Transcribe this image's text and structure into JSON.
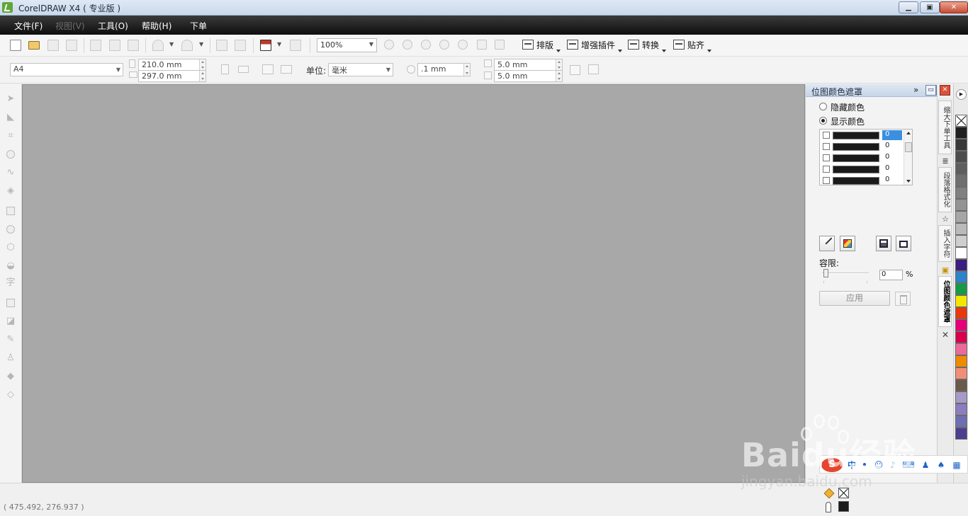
{
  "window": {
    "title": "CorelDRAW X4 ( 专业版 )",
    "buttons": {
      "minimize": "▁",
      "restore": "▣",
      "close": "✕"
    }
  },
  "menu": [
    {
      "label": "文件(F)",
      "enabled": true
    },
    {
      "label": "视图(V)",
      "enabled": false
    },
    {
      "label": "工具(O)",
      "enabled": true
    },
    {
      "label": "帮助(H)",
      "enabled": true
    },
    {
      "label": "下单",
      "enabled": true
    }
  ],
  "toolbar": {
    "zoom": "100%",
    "plugins": [
      "排版",
      "增强插件",
      "转换",
      "贴齐"
    ]
  },
  "property_bar": {
    "page_size": "A4",
    "width": "210.0 mm",
    "height": "297.0 mm",
    "units_label": "单位:",
    "units": "毫米",
    "nudge": ".1 mm",
    "dup_x": "5.0 mm",
    "dup_y": "5.0 mm"
  },
  "docker": {
    "title": "位图颜色遮罩",
    "radio_hide": "隐藏颜色",
    "radio_show": "显示颜色",
    "selected_mode": "show",
    "colors": [
      {
        "value": "0",
        "selected": true
      },
      {
        "value": "0",
        "selected": false
      },
      {
        "value": "0",
        "selected": false
      },
      {
        "value": "0",
        "selected": false
      },
      {
        "value": "0",
        "selected": false
      }
    ],
    "tolerance_label": "容限:",
    "tolerance_value": "0",
    "percent": "%",
    "apply_label": "应用"
  },
  "side_tabs": [
    "缩大下单工具",
    "段落格式化",
    "插入字符",
    "位图颜色遮罩"
  ],
  "palette": {
    "colors": [
      "#1f1f1f",
      "#383838",
      "#4d4d4d",
      "#5e5e5e",
      "#6f6f6f",
      "#808080",
      "#939393",
      "#a6a6a6",
      "#bababa",
      "#cfcfcf",
      "#ffffff",
      "#3a1f80",
      "#2f83c9",
      "#179a45",
      "#f5e600",
      "#e8380d",
      "#e5007a",
      "#d8004c",
      "#ec6a9a",
      "#ee8b00",
      "#f28e78",
      "#6b5a4a",
      "#a89ac6",
      "#8b7dbf",
      "#6d6fb2",
      "#4c3f8f"
    ]
  },
  "status": {
    "coords": "( 475.492, 276.937 )"
  },
  "watermark": {
    "main": "Baidu经验",
    "sub": "jingyan.baidu.com"
  }
}
